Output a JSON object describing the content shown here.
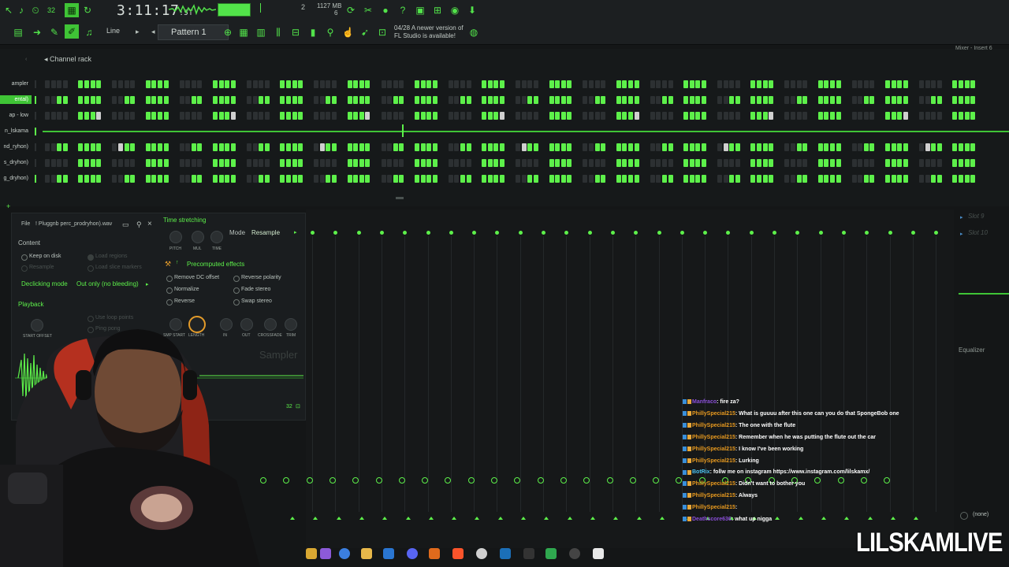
{
  "toolbar": {
    "time_main": "3:11:17",
    "time_small": ":5T",
    "mem_value": "1127 MB",
    "mem_sub": "6",
    "cpu_value": "2",
    "pattern_label": "Pattern 1",
    "snap_label": "Line",
    "news_date": "04/28",
    "news_line1": "A newer version of",
    "news_line2": "FL Studio is available!",
    "mode_label": "32"
  },
  "channel_rack": {
    "title": "Channel rack",
    "mixer_title": "Mixer - Insert 6",
    "channels": [
      {
        "label": "ampler",
        "active": false
      },
      {
        "label": "ental)",
        "active": true
      },
      {
        "label": "ap - low",
        "active": false
      },
      {
        "label": "n_lskama",
        "active": false
      },
      {
        "label": "nd_ryhon)",
        "active": false
      },
      {
        "label": "s_dryhon)",
        "active": false
      },
      {
        "label": "g_dryhon)",
        "active": false
      }
    ]
  },
  "sampler": {
    "file_label": "File",
    "file_name": "! Pluggnb perc_prodryhon).wav",
    "content_heading": "Content",
    "keep_on_disk": "Keep on disk",
    "resample": "Resample",
    "load_regions": "Load regions",
    "load_slice_markers": "Load slice markers",
    "declicking_label": "Declicking mode",
    "declicking_value": "Out only (no bleeding)",
    "playback_heading": "Playback",
    "use_loop_points": "Use loop points",
    "ping_pong": "Ping pong",
    "start_offset": "Start offset",
    "time_stretching": "Time stretching",
    "mode_label": "Mode",
    "mode_value": "Resample",
    "pitch": "Pitch",
    "mul": "Mul",
    "time": "Time",
    "precomputed": "Precomputed effects",
    "remove_dc": "Remove DC offset",
    "normalize": "Normalize",
    "reverse": "Reverse",
    "reverse_polarity": "Reverse polarity",
    "fade_stereo": "Fade stereo",
    "swap_stereo": "Swap stereo",
    "knob_smp_start": "Smp start",
    "knob_length": "Length",
    "knob_in": "In",
    "knob_out": "Out",
    "knob_crossfade": "Crossfade",
    "knob_trim": "Trim",
    "title": "Sampler",
    "bits": "32"
  },
  "mixer": {
    "slot9": "Slot 9",
    "slot10": "Slot 10",
    "equalizer": "Equalizer",
    "none": "(none)"
  },
  "chat": [
    {
      "user": "Manfraco",
      "text": ": fire za?",
      "color": "#8a4fd8"
    },
    {
      "user": "PhillySpecial215",
      "text": ": What is guuuu after this one can you do that SpongeBob one",
      "color": "#e89a1f"
    },
    {
      "user": "PhillySpecial215",
      "text": ": The one with the flute",
      "color": "#e89a1f"
    },
    {
      "user": "PhillySpecial215",
      "text": ": Remember when he was putting the flute out the car",
      "color": "#e89a1f"
    },
    {
      "user": "PhillySpecial215",
      "text": ": I know I've been working",
      "color": "#e89a1f"
    },
    {
      "user": "PhillySpecial215",
      "text": ": Lurking",
      "color": "#e89a1f"
    },
    {
      "user": "BotRix",
      "text": ": follw me on instagram https://www.instagram.com/lilskamx/",
      "color": "#4cc2f0"
    },
    {
      "user": "PhillySpecial215",
      "text": ": Didn't want to bother you",
      "color": "#e89a1f"
    },
    {
      "user": "PhillySpecial215",
      "text": ": Always",
      "color": "#e89a1f"
    },
    {
      "user": "PhillySpecial215",
      "text": ": ",
      "color": "#e89a1f"
    },
    {
      "user": "Deathscore636",
      "text": ": what up nigga",
      "color": "#8a4fd8"
    }
  ],
  "brand": "LILSKAMLIVE",
  "colors": {
    "accent": "#5df04a",
    "panel": "#1a1d1f",
    "background": "#141617"
  }
}
